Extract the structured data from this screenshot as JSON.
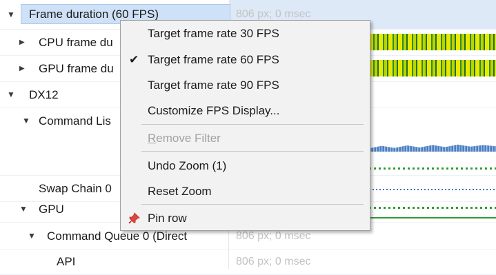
{
  "tree": {
    "rows": [
      {
        "label": "Frame duration (60 FPS)",
        "info": "806 px; 0 msec"
      },
      {
        "label": "CPU frame du"
      },
      {
        "label": "GPU frame du"
      },
      {
        "label": "DX12"
      },
      {
        "label": "Command Lis"
      },
      {
        "label": "Swap Chain 0"
      },
      {
        "label": "GPU"
      },
      {
        "label": "Command Queue 0 (Direct",
        "info": "806 px; 0 msec"
      },
      {
        "label": "API",
        "info": "806 px; 0 msec"
      }
    ]
  },
  "menu": {
    "items": [
      {
        "label": "Target frame rate 30 FPS"
      },
      {
        "label": "Target frame rate 60 FPS",
        "checked": true
      },
      {
        "label": "Target frame rate 90 FPS"
      },
      {
        "label": "Customize FPS Display..."
      },
      {
        "label_underlined": "R",
        "label_rest": "emove Filter",
        "disabled": true
      },
      {
        "label": "Undo Zoom (1)"
      },
      {
        "label": "Reset Zoom"
      },
      {
        "label": "Pin row",
        "icon": "pin-icon"
      }
    ],
    "check_glyph": "✔"
  },
  "icons": {
    "expanded": "▼",
    "collapsed": "▶"
  }
}
